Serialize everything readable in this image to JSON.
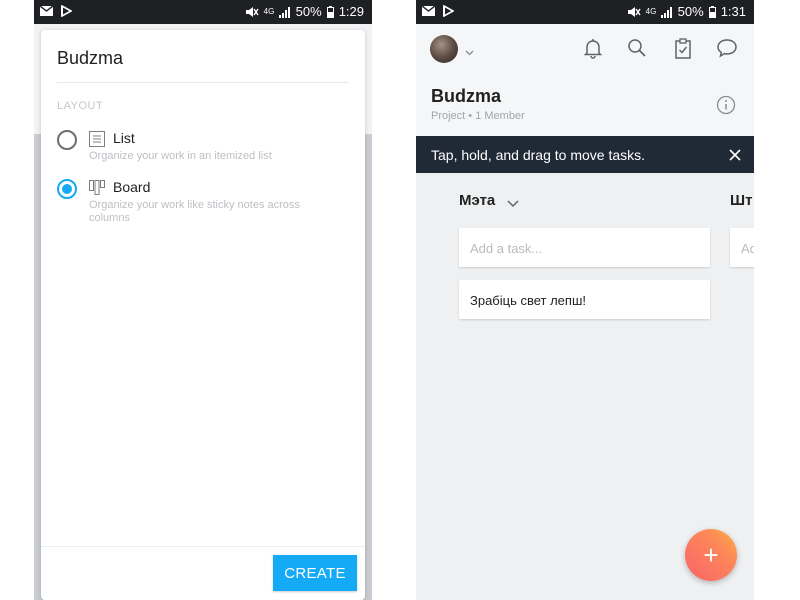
{
  "left_screen": {
    "status_bar": {
      "network": "4G",
      "battery": "50%",
      "time": "1:29"
    },
    "dialog": {
      "title": "Budzma",
      "section_label": "LAYOUT",
      "options": [
        {
          "label": "List",
          "description": "Organize your work in an itemized list",
          "selected": false,
          "icon": "list-layout-icon"
        },
        {
          "label": "Board",
          "description": "Organize your work like sticky notes across columns",
          "selected": true,
          "icon": "board-layout-icon"
        }
      ],
      "create_label": "CREATE"
    }
  },
  "right_screen": {
    "status_bar": {
      "network": "4G",
      "battery": "50%",
      "time": "1:31"
    },
    "header_icons": [
      "bell-icon",
      "search-icon",
      "clipboard-check-icon",
      "chat-bubble-icon"
    ],
    "project": {
      "title": "Budzma",
      "subtitle": "Project • 1 Member"
    },
    "toast": {
      "text": "Tap, hold, and drag to move tasks."
    },
    "columns": [
      {
        "title": "Мэта",
        "add_placeholder": "Add a task...",
        "tasks": [
          "Зрабіць свет лепш!"
        ]
      },
      {
        "title": "Шт",
        "add_placeholder": "Ad"
      }
    ],
    "fab_label": "+"
  },
  "colors": {
    "accent": "#14aaf5",
    "status_bar": "#1f2024",
    "toast_bg": "#1f2a36",
    "fab_gradient": [
      "#fc636b",
      "#ffb33e"
    ]
  }
}
